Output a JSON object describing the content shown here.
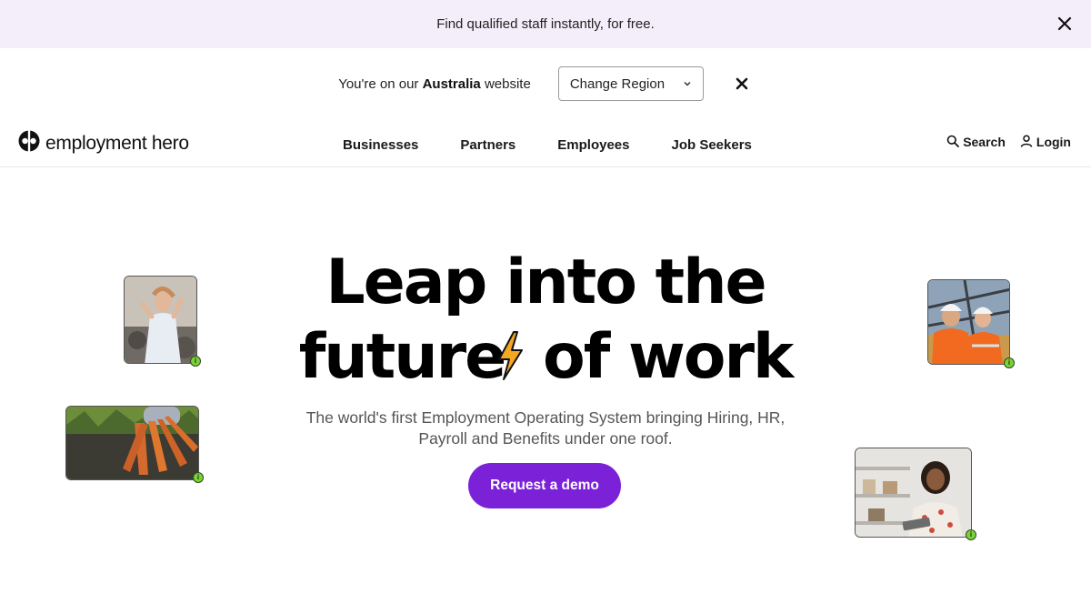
{
  "promo": {
    "text": "Find qualified staff instantly, for free.",
    "close_icon": "close-icon"
  },
  "region": {
    "prefix": "You're on our",
    "country": "Australia",
    "suffix": "website",
    "select_label": "Change Region",
    "close_icon": "close-icon"
  },
  "nav": {
    "logo_text": "employment hero",
    "links": [
      "Businesses",
      "Partners",
      "Employees",
      "Job Seekers"
    ],
    "search_label": "Search",
    "login_label": "Login"
  },
  "hero": {
    "title_line1": "Leap into the",
    "title_line2_a": "future",
    "title_line2_b": "of work",
    "subtitle_line1": "The world's first Employment Operating System bringing Hiring, HR,",
    "subtitle_line2": "Payroll and Benefits under one roof.",
    "cta_label": "Request a demo"
  },
  "photo_badge": "i",
  "colors": {
    "promo_bg": "#f3eefa",
    "accent": "#7b22d9",
    "badge": "#7bd13a",
    "bolt": "#f5a623"
  }
}
